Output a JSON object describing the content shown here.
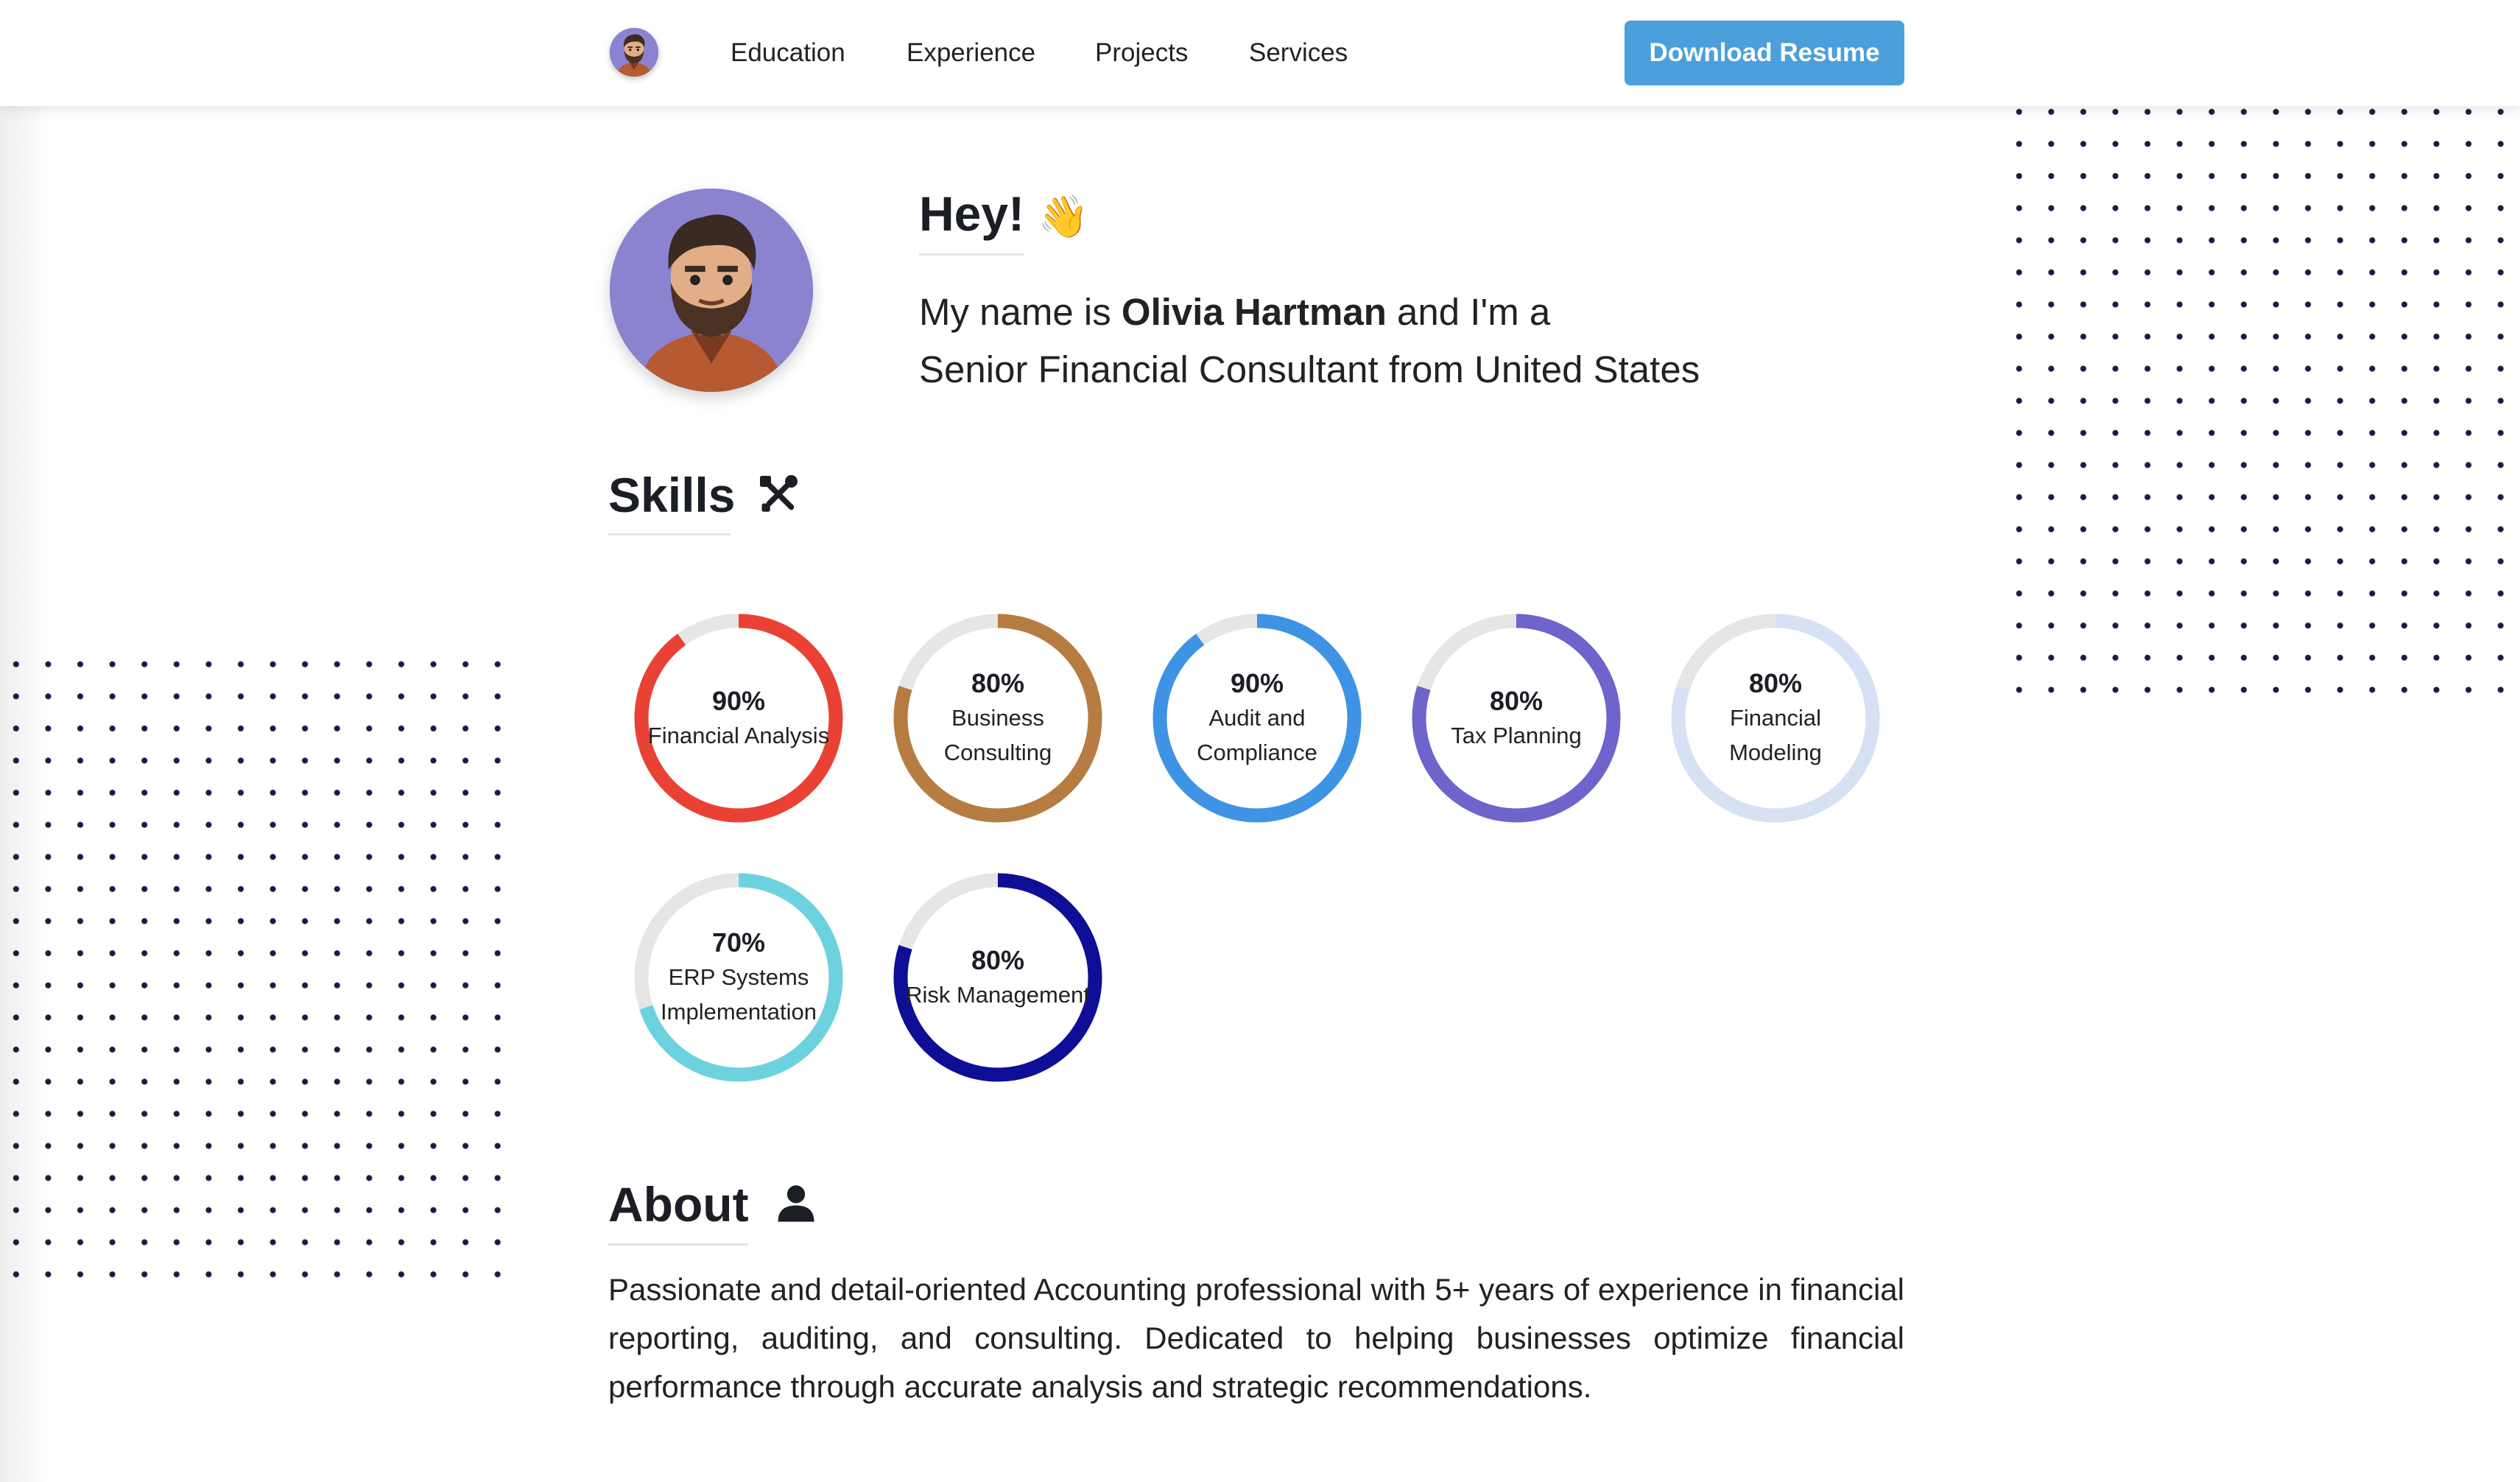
{
  "nav": {
    "links": [
      "Education",
      "Experience",
      "Projects",
      "Services"
    ],
    "download_label": "Download Resume"
  },
  "hero": {
    "greeting": "Hey!",
    "greeting_emoji": "👋",
    "intro_prefix": "My name is ",
    "name": "Olivia Hartman",
    "intro_suffix": " and I'm a",
    "role_line": "Senior Financial Consultant from United States"
  },
  "skills": {
    "title": "Skills",
    "icon": "tools-icon",
    "items": [
      {
        "percent": "90%",
        "value": 0.9,
        "label": "Financial Analysis",
        "color": "#e94235"
      },
      {
        "percent": "80%",
        "value": 0.8,
        "label": "Business Consulting",
        "color": "#b67c42"
      },
      {
        "percent": "90%",
        "value": 0.9,
        "label": "Audit and Compliance",
        "color": "#3f93e4"
      },
      {
        "percent": "80%",
        "value": 0.8,
        "label": "Tax Planning",
        "color": "#6f63cc"
      },
      {
        "percent": "80%",
        "value": 0.8,
        "label": "Financial Modeling",
        "color": "#d6e1f4"
      },
      {
        "percent": "70%",
        "value": 0.7,
        "label": "ERP Systems Implementation",
        "color": "#6dd2df"
      },
      {
        "percent": "80%",
        "value": 0.8,
        "label": "Risk Management",
        "color": "#0e0e96"
      }
    ]
  },
  "about": {
    "title": "About",
    "icon": "user-icon",
    "text": "Passionate and detail-oriented Accounting professional with 5+ years of experience in financial reporting, auditing, and consulting. Dedicated to helping businesses optimize financial performance through accurate analysis and strategic recommendations."
  }
}
